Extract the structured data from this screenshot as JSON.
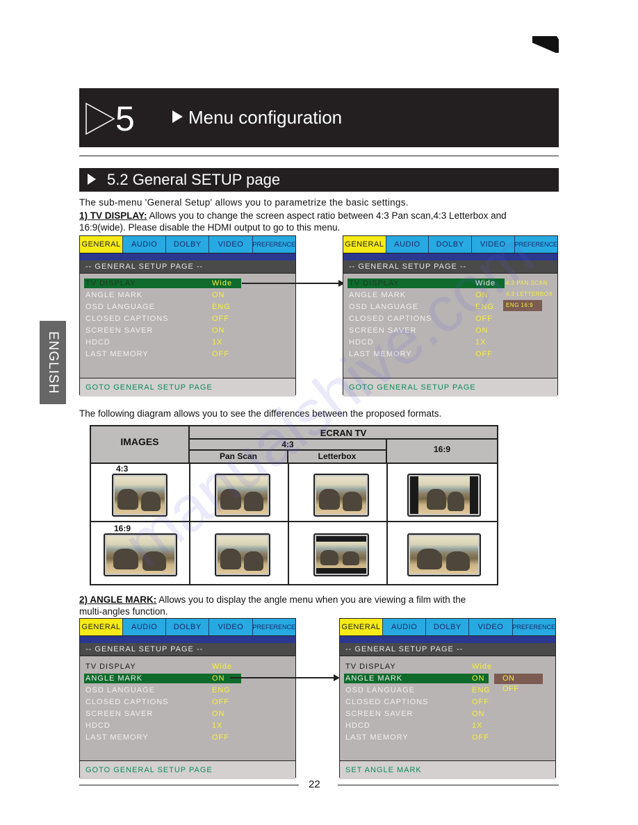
{
  "chapter": {
    "number": "5",
    "title": "Menu configuration"
  },
  "section": {
    "title": "5.2 General SETUP page"
  },
  "sidebar": {
    "language": "ENGLISH"
  },
  "intro": "The sub-menu 'General Setup' allows you to parametrize the basic settings.",
  "item1": {
    "keyword": "1) TV DISPLAY:",
    "line1": " Allows you to change the screen aspect ratio between 4:3 Pan scan,4:3 Letterbox and",
    "line2": "16:9(wide). Please disable the HDMI output to go to this menu."
  },
  "osd": {
    "tabs": [
      "GENERAL",
      "AUDIO",
      "DOLBY",
      "VIDEO",
      "PREFERENCE"
    ],
    "page_title": "-- GENERAL SETUP PAGE --",
    "rows": [
      {
        "label": "TV DISPLAY",
        "value": "Wide"
      },
      {
        "label": "ANGLE MARK",
        "value": "ON"
      },
      {
        "label": "OSD LANGUAGE",
        "value": "ENG"
      },
      {
        "label": "CLOSED CAPTIONS",
        "value": "OFF"
      },
      {
        "label": "SCREEN SAVER",
        "value": "ON"
      },
      {
        "label": "HDCD",
        "value": "1X"
      },
      {
        "label": "LAST MEMORY",
        "value": "OFF"
      }
    ],
    "footer_goto": "GOTO GENERAL SETUP PAGE",
    "footer_angle": "SET ANGLE MARK",
    "tv_display_options": [
      "4:3 PAN SCAN",
      "4:3 LETTERBOX",
      "ENG 16:9"
    ],
    "angle_mark_options": [
      "ON",
      "OFF"
    ],
    "colors": {
      "tab_active": "#f6eb16",
      "tab": "#27a9e1",
      "selected_row": "#0e6b2c",
      "value": "#f7ef3a",
      "footer_text": "#0f8a5a"
    }
  },
  "diagram_intro": "The following diagram allows you to see the differences between the proposed formats.",
  "diagram": {
    "images_header": "IMAGES",
    "screen_header": "ECRAN TV",
    "sub_43": "4:3",
    "pan_scan": "Pan Scan",
    "letterbox": "Letterbox",
    "sub_169": "16:9",
    "row_labels": [
      "4:3",
      "16:9"
    ]
  },
  "item2": {
    "keyword": "2) ANGLE MARK:",
    "line1": " Allows you to display the angle menu when you are viewing a film with the",
    "line2": "multi-angles function."
  },
  "page_number": "22"
}
